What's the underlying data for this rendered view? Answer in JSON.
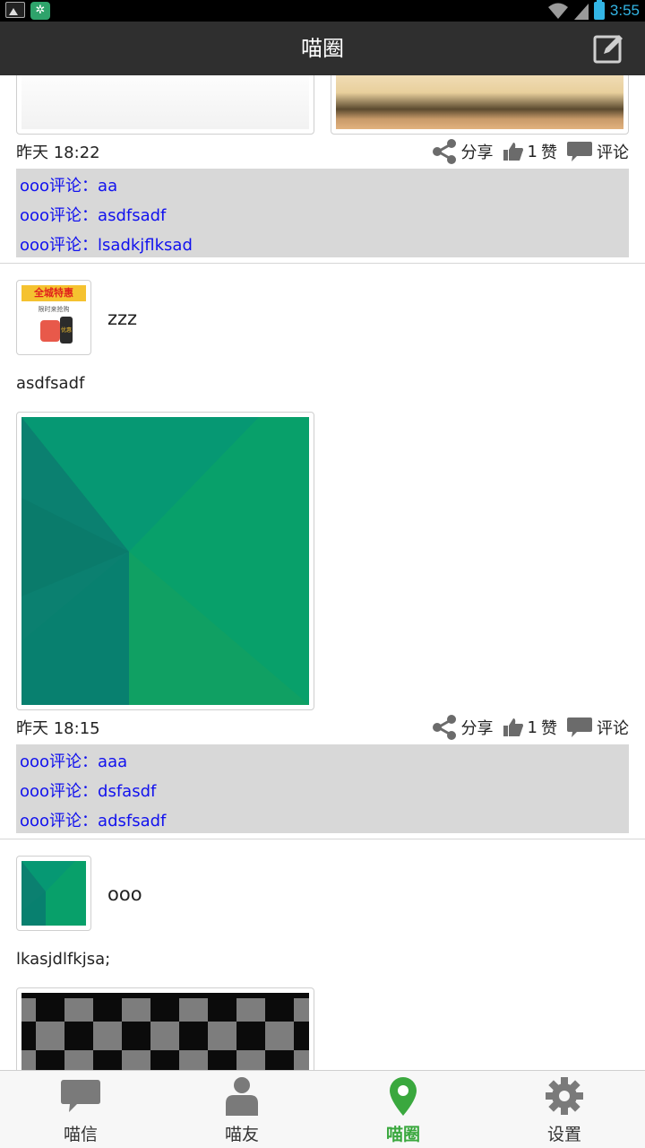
{
  "status_bar": {
    "time": "3:55"
  },
  "header": {
    "title": "喵圈",
    "edit_icon": "edit-icon"
  },
  "posts": [
    {
      "time": "昨天 18:22",
      "share_label": "分享",
      "like_count": "1",
      "like_label": "赞",
      "comment_label": "评论",
      "comments": [
        {
          "text": "ooo评论：aa"
        },
        {
          "text": "ooo评论：asdfsadf"
        },
        {
          "text": "ooo评论：lsadkjflksad"
        }
      ]
    },
    {
      "username": "zzz",
      "avatar_title": "全城特惠",
      "avatar_subtitle": "限时来抢购",
      "avatar_badge": "优惠",
      "text": "asdfsadf",
      "time": "昨天 18:15",
      "share_label": "分享",
      "like_count": "1",
      "like_label": "赞",
      "comment_label": "评论",
      "comments": [
        {
          "text": "ooo评论：aaa"
        },
        {
          "text": "ooo评论：dsfasdf"
        },
        {
          "text": "ooo评论：adsfsadf"
        }
      ]
    },
    {
      "username": "ooo",
      "text": "lkasjdlfkjsa;"
    }
  ],
  "bottom_nav": [
    {
      "label": "喵信",
      "icon": "chat-bubble-icon",
      "active": false
    },
    {
      "label": "喵友",
      "icon": "person-icon",
      "active": false
    },
    {
      "label": "喵圈",
      "icon": "location-pin-icon",
      "active": true
    },
    {
      "label": "设置",
      "icon": "gear-icon",
      "active": false
    }
  ],
  "colors": {
    "accent_green": "#3aa83e",
    "comment_link": "#1111ee",
    "comment_bg": "#d8d8d8",
    "titlebar_bg": "#2f2f2f"
  }
}
